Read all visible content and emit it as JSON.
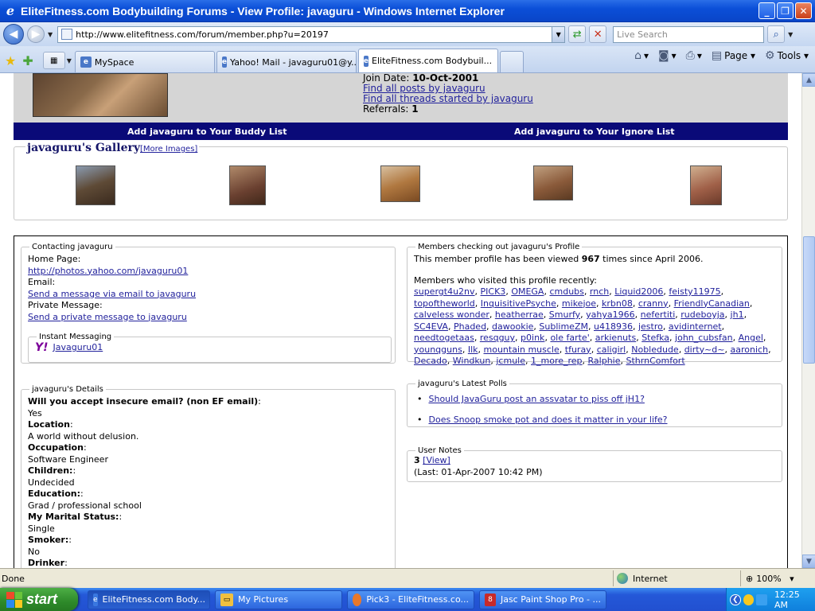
{
  "window": {
    "title": "EliteFitness.com Bodybuilding Forums - View Profile: javaguru - Windows Internet Explorer",
    "minimize": "_",
    "restore": "❐",
    "close": "✕"
  },
  "addressbar": {
    "url": "http://www.elitefitness.com/forum/member.php?u=20197",
    "search_placeholder": "Live Search"
  },
  "tabs": [
    {
      "label": "MySpace"
    },
    {
      "label": "Yahoo! Mail - javaguru01@y..."
    },
    {
      "label": "EliteFitness.com Bodybuil..."
    }
  ],
  "toolbar": {
    "page_label": "Page",
    "tools_label": "Tools"
  },
  "profile": {
    "join_date_label": "Join Date:",
    "join_date_value": "10-Oct-2001",
    "find_posts": "Find all posts by javaguru",
    "find_threads": "Find all threads started by javaguru",
    "referrals_label": "Referrals:",
    "referrals_value": "1",
    "add_buddy": "Add javaguru to Your Buddy List",
    "add_ignore": "Add javaguru to Your Ignore List"
  },
  "gallery": {
    "title": "javaguru's Gallery",
    "more_images": "[More Images]"
  },
  "contacting": {
    "legend": "Contacting javaguru",
    "home_page_label": "Home Page:",
    "home_page_url": "http://photos.yahoo.com/javaguru01",
    "email_label": "Email:",
    "email_link": "Send a message via email to javaguru",
    "pm_label": "Private Message:",
    "pm_link": "Send a private message to javaguru",
    "im_legend": "Instant Messaging",
    "yahoo_id": "Javaguru01"
  },
  "details": {
    "legend": "javaguru's Details",
    "items": [
      {
        "q": "Will you accept insecure email? (non EF email)",
        "suffix": ":",
        "a": "Yes"
      },
      {
        "q": "Location",
        "suffix": ":",
        "a": "A world without delusion."
      },
      {
        "q": "Occupation",
        "suffix": ":",
        "a": "Software Engineer"
      },
      {
        "q": "Children:",
        "suffix": ":",
        "a": "Undecided"
      },
      {
        "q": "Education:",
        "suffix": ":",
        "a": "Grad / professional school"
      },
      {
        "q": "My Marital Status:",
        "suffix": ":",
        "a": "Single"
      },
      {
        "q": "Smoker:",
        "suffix": ":",
        "a": "No"
      },
      {
        "q": "Drinker",
        "suffix": ":",
        "a": ""
      }
    ]
  },
  "visitors": {
    "legend": "Members checking out javaguru's Profile",
    "viewed_prefix": "This member profile has been viewed",
    "viewed_count": "967",
    "viewed_suffix": "times since April 2006.",
    "recent_label": "Members who visited this profile recently:",
    "names": [
      "supergt4u2nv",
      "PICK3",
      "OMEGA",
      "cmdubs",
      "rnch",
      "Liquid2006",
      "feisty11975",
      "topoftheworld",
      "InquisitivePsyche",
      "mikejoe",
      "krbn08",
      "cranny",
      "FriendlyCanadian",
      "calveless wonder",
      "heatherrae",
      "Smurfy",
      "yahya1966",
      "nefertiti",
      "rudeboyja",
      "jh1",
      "SC4EVA",
      "Phaded",
      "dawookie",
      "SublimeZM",
      "u418936",
      "jestro",
      "avidinternet",
      "needtogetaas",
      "resqguy",
      "p0ink",
      "ole farte'",
      "arkienuts",
      "Stefka",
      "john_cubsfan",
      "Angel",
      "younqguns",
      "Ilk",
      "mountain muscle",
      "tfuray",
      "caligirl",
      "Nobledude",
      "dirty~d~",
      "aaronich",
      "Decado",
      "Windkun",
      "jcmule",
      "1_more_rep",
      "Ralphie",
      "SthrnComfort"
    ]
  },
  "polls": {
    "legend": "javaguru's Latest Polls",
    "items": [
      "Should JavaGuru post an assvatar to piss off jH1?",
      "Does Snoop smoke pot and does it matter in your life?"
    ]
  },
  "notes": {
    "legend": "User Notes",
    "count": "3",
    "view_link": "[View]",
    "last": "(Last: 01-Apr-2007 10:42 PM)"
  },
  "status": {
    "text": "Done",
    "zone": "Internet",
    "zoom": "100%"
  },
  "taskbar": {
    "start": "start",
    "items": [
      "EliteFitness.com Body...",
      "My Pictures",
      "Pick3 - EliteFitness.co...",
      "Jasc Paint Shop Pro - ..."
    ],
    "clock": "12:25 AM"
  }
}
